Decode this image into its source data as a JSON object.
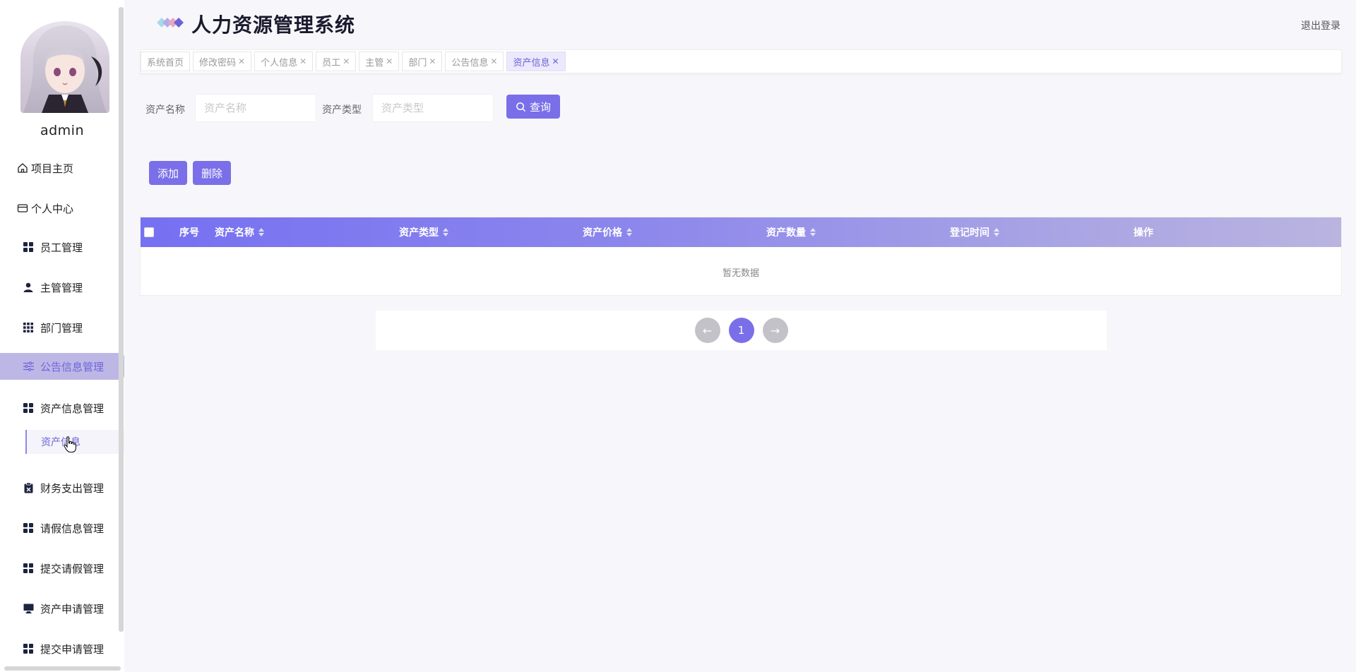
{
  "app": {
    "title": "人力资源管理系统",
    "logout_label": "退出登录"
  },
  "user": {
    "name": "admin"
  },
  "sidebar": {
    "items": [
      {
        "label": "项目主页",
        "icon": "home-icon"
      },
      {
        "label": "个人中心",
        "icon": "card-icon"
      },
      {
        "label": "员工管理",
        "icon": "grid-icon"
      },
      {
        "label": "主管管理",
        "icon": "user-icon"
      },
      {
        "label": "部门管理",
        "icon": "apps-icon"
      },
      {
        "label": "公告信息管理",
        "icon": "sliders-icon"
      },
      {
        "label": "资产信息管理",
        "icon": "grid-icon"
      },
      {
        "label": "财务支出管理",
        "icon": "clipboard-icon"
      },
      {
        "label": "请假信息管理",
        "icon": "grid-icon"
      },
      {
        "label": "提交请假管理",
        "icon": "grid-icon"
      },
      {
        "label": "资产申请管理",
        "icon": "monitor-icon"
      },
      {
        "label": "提交申请管理",
        "icon": "grid-icon"
      }
    ],
    "submenu": {
      "label": "资产信息"
    }
  },
  "tabs": [
    {
      "label": "系统首页",
      "closable": false
    },
    {
      "label": "修改密码",
      "closable": true
    },
    {
      "label": "个人信息",
      "closable": true
    },
    {
      "label": "员工",
      "closable": true
    },
    {
      "label": "主管",
      "closable": true
    },
    {
      "label": "部门",
      "closable": true
    },
    {
      "label": "公告信息",
      "closable": true
    },
    {
      "label": "资产信息",
      "closable": true,
      "active": true
    }
  ],
  "search": {
    "name_label": "资产名称",
    "name_placeholder": "资产名称",
    "name_value": "",
    "type_label": "资产类型",
    "type_placeholder": "资产类型",
    "type_value": "",
    "query_label": "查询"
  },
  "actions": {
    "add_label": "添加",
    "delete_label": "删除"
  },
  "table": {
    "columns": [
      "序号",
      "资产名称",
      "资产类型",
      "资产价格",
      "资产数量",
      "登记时间",
      "操作"
    ],
    "rows": [],
    "empty_text": "暂无数据"
  },
  "pagination": {
    "prev": "←",
    "current": "1",
    "next": "→"
  },
  "colors": {
    "accent": "#7a6fe8",
    "active_menu_bg": "#bdb7e6",
    "page_bg": "#f7f7fb"
  }
}
